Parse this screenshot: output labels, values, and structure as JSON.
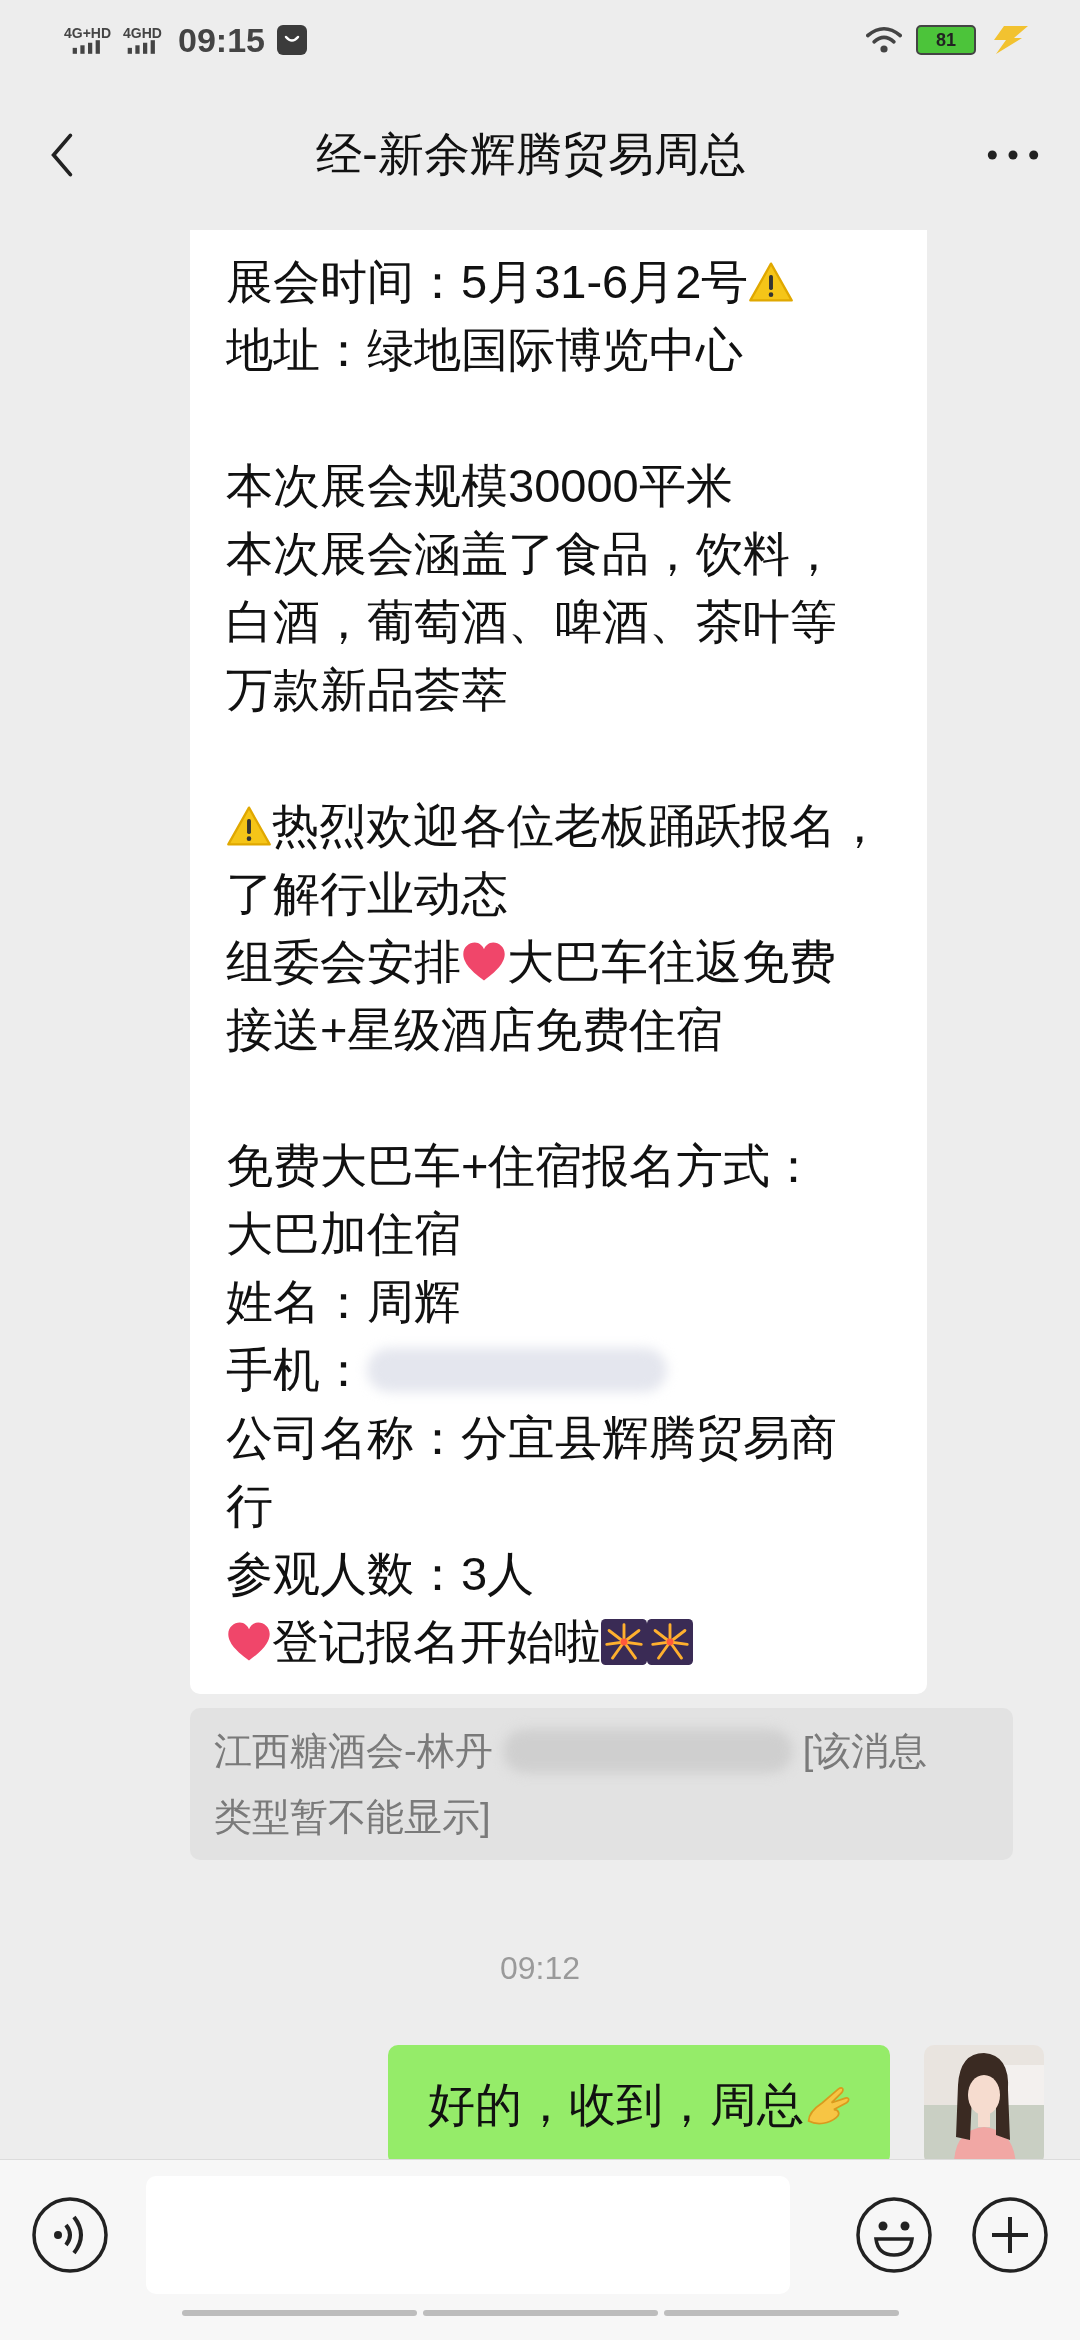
{
  "status_bar": {
    "networks": [
      "4G+HD",
      "4GHD"
    ],
    "time": "09:15",
    "battery": "81"
  },
  "header": {
    "title": "经-新余辉腾贸易周总"
  },
  "chat": [
    {
      "kind": "received",
      "paragraphs": [
        [
          [
            {
              "kind": "text",
              "text": "展会时间：5月31-6月2号"
            },
            {
              "kind": "warning"
            }
          ],
          [
            {
              "kind": "text",
              "text": "地址：绿地国际博览中心"
            }
          ]
        ],
        [
          [
            {
              "kind": "text",
              "text": "本次展会规模30000平米"
            }
          ],
          [
            {
              "kind": "text",
              "text": "本次展会涵盖了食品，饮料，"
            }
          ],
          [
            {
              "kind": "text",
              "text": "白酒，葡萄酒、啤酒、茶叶等"
            }
          ],
          [
            {
              "kind": "text",
              "text": "万款新品荟萃"
            }
          ]
        ],
        [
          [
            {
              "kind": "warning"
            },
            {
              "kind": "text",
              "text": "热烈欢迎各位老板踊跃报名，"
            }
          ],
          [
            {
              "kind": "text",
              "text": "了解行业动态"
            }
          ],
          [
            {
              "kind": "text",
              "text": "组委会安排"
            },
            {
              "kind": "heart"
            },
            {
              "kind": "text",
              "text": "大巴车往返免费"
            }
          ],
          [
            {
              "kind": "text",
              "text": "接送+星级酒店免费住宿"
            }
          ]
        ],
        [
          [
            {
              "kind": "text",
              "text": "免费大巴车+住宿报名方式："
            }
          ],
          [
            {
              "kind": "text",
              "text": "大巴加住宿"
            }
          ],
          [
            {
              "kind": "text",
              "text": "姓名：周辉"
            }
          ],
          [
            {
              "kind": "text",
              "text": "手机："
            },
            {
              "kind": "redacted"
            }
          ],
          [
            {
              "kind": "text",
              "text": "公司名称：分宜县辉腾贸易商"
            }
          ],
          [
            {
              "kind": "text",
              "text": "行"
            }
          ],
          [
            {
              "kind": "text",
              "text": "参观人数：3人"
            }
          ],
          [
            {
              "kind": "heart"
            },
            {
              "kind": "text",
              "text": "登记报名开始啦"
            },
            {
              "kind": "fireworks"
            },
            {
              "kind": "fireworks"
            }
          ]
        ]
      ]
    },
    {
      "kind": "quote",
      "lines": [
        [
          {
            "kind": "text",
            "text": "江西糖酒会-林丹"
          },
          {
            "kind": "redacted"
          },
          {
            "kind": "text",
            "text": "[该消息"
          }
        ],
        [
          {
            "kind": "text",
            "text": "类型暂不能显示]"
          }
        ]
      ]
    },
    {
      "kind": "timestamp",
      "text": "09:12"
    },
    {
      "kind": "sent",
      "segments": [
        {
          "kind": "text",
          "text": "好的，收到，周总"
        },
        {
          "kind": "hand"
        }
      ],
      "avatar": {
        "kind": "picture"
      }
    }
  ]
}
